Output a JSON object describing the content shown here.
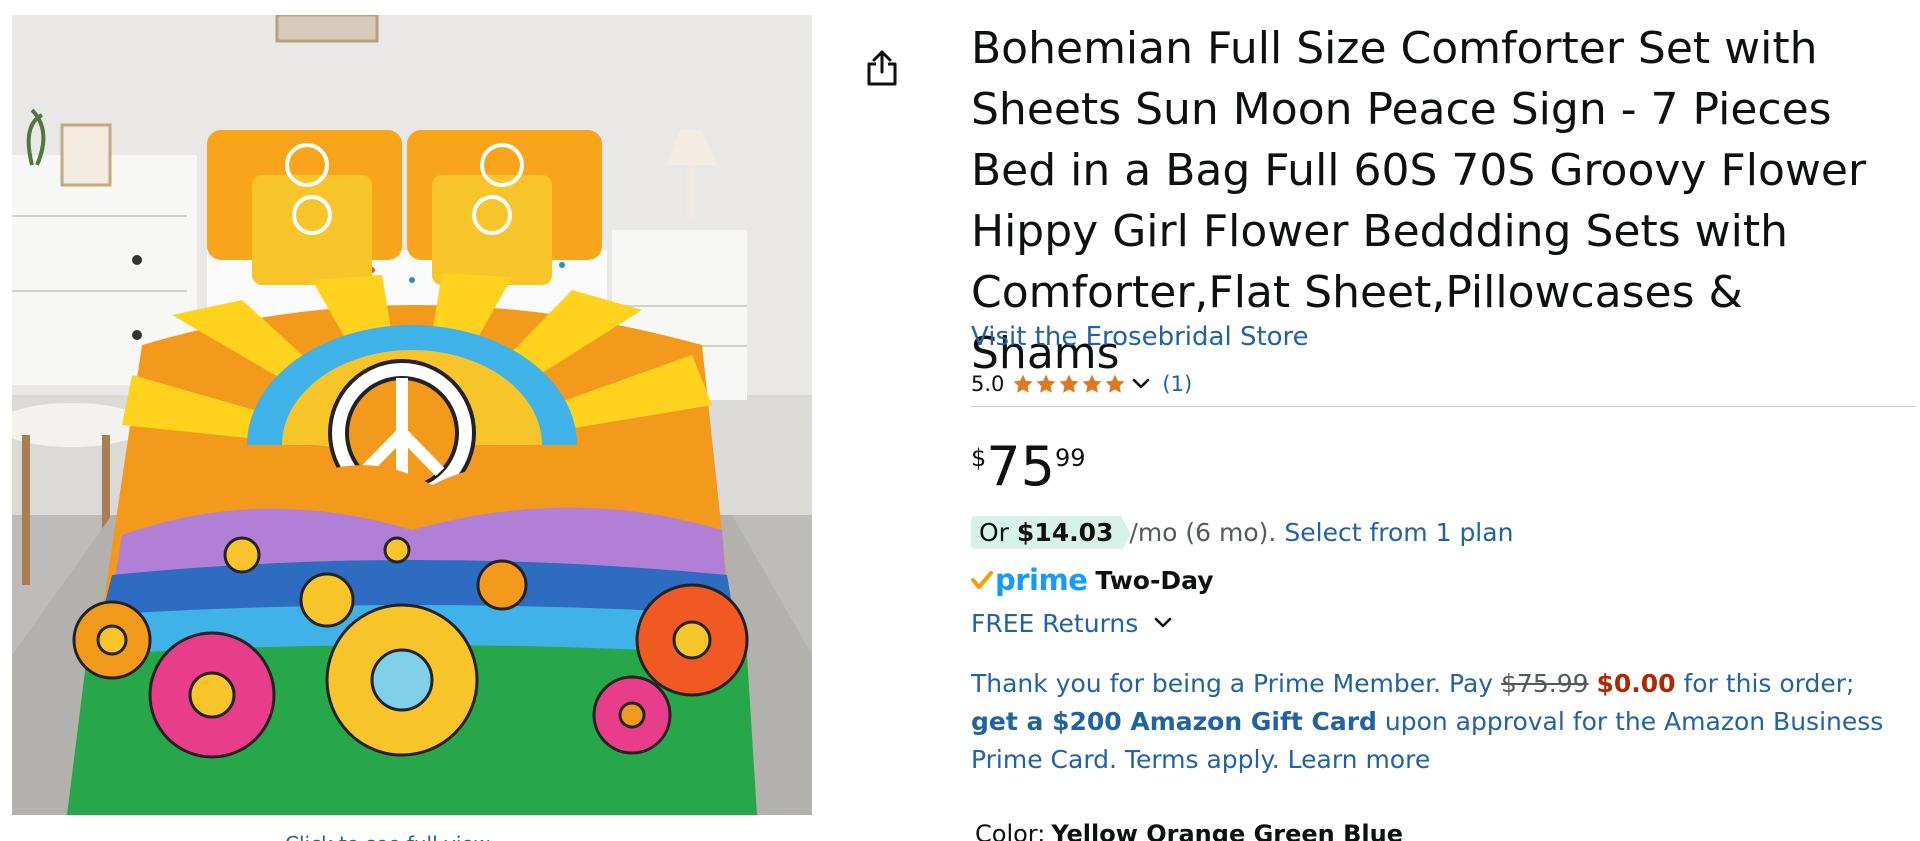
{
  "product": {
    "title": "Bohemian Full Size Comforter Set with Sheets Sun Moon Peace Sign - 7 Pieces Bed in a Bag Full 60S 70S Groovy Flower Hippy Girl Flower Beddding Sets with Comforter,Flat Sheet,Pillowcases & Shams",
    "store_link": "Visit the Erosebridal Store",
    "image_caption": "Click to see full view"
  },
  "rating": {
    "value": "5.0",
    "stars": 5,
    "count_text": "(1)"
  },
  "price": {
    "symbol": "$",
    "whole": "75",
    "fraction": "99"
  },
  "installment": {
    "prefix": "Or",
    "amount": "$14.03",
    "term": "/mo (6 mo).",
    "plan_link": "Select from 1 plan"
  },
  "shipping": {
    "prime_label": "prime",
    "speed": "Two-Day",
    "returns": "FREE Returns"
  },
  "promo": {
    "lead": "Thank you for being a Prime Member. Pay",
    "old_price": "$75.99",
    "new_price": "$0.00",
    "mid": "for this order;",
    "bold_link": "get a $200 Amazon Gift Card",
    "tail": "upon approval for the Amazon Business Prime Card. Terms apply.",
    "learn_more": "Learn more"
  },
  "color": {
    "label": "Color:",
    "value": "Yellow Orange Green Blue"
  },
  "colors": {
    "link": "#2162a1",
    "star": "#de7921",
    "prime_blue": "#1399ff",
    "prime_check": "#ff9900",
    "deal_red": "#b12704",
    "pill_bg": "#d7f2e8"
  },
  "icons": {
    "share": "share-icon",
    "star": "star-icon",
    "chevron": "chevron-down-icon",
    "prime_check": "prime-check-icon"
  }
}
